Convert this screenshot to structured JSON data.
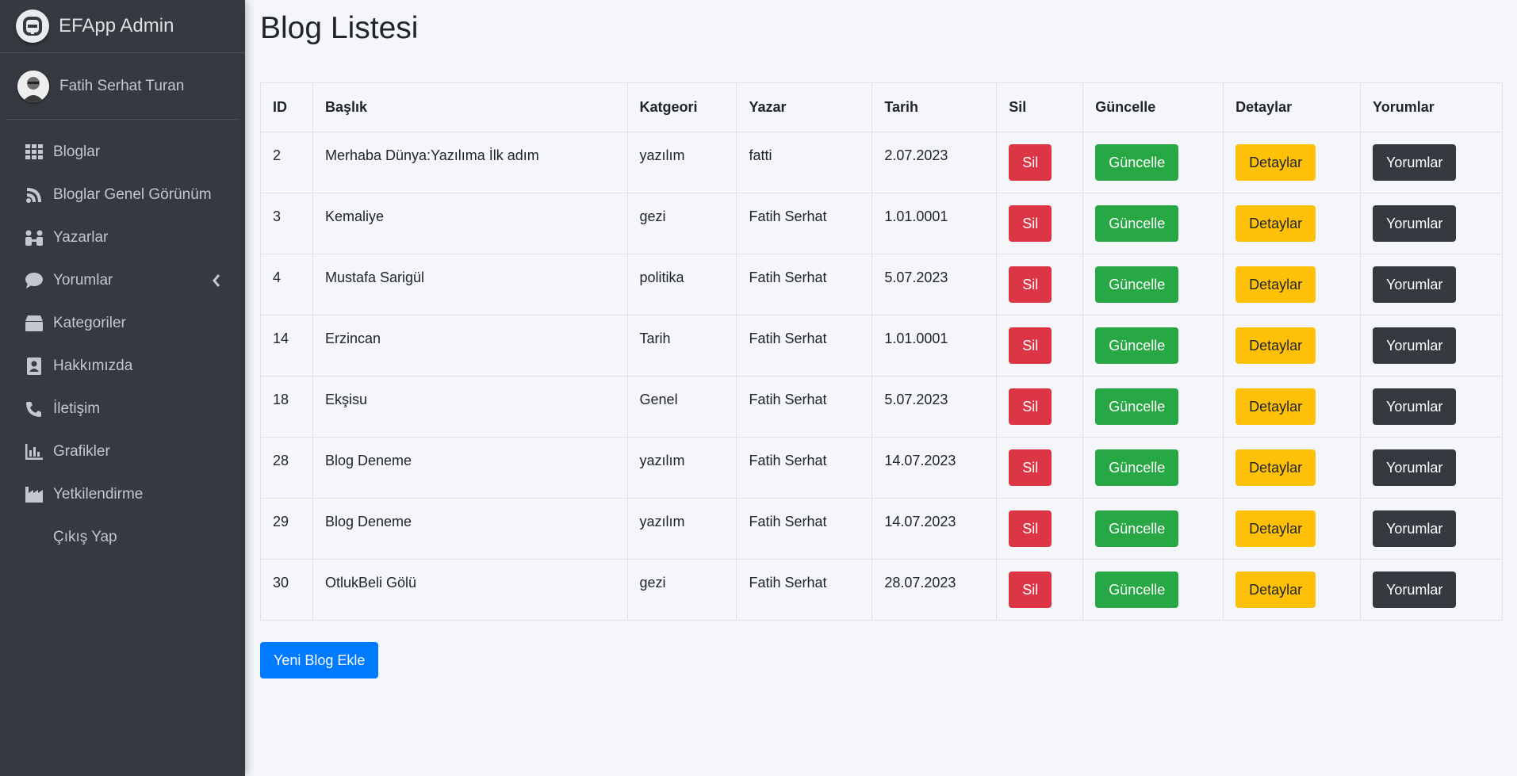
{
  "brand": {
    "title": "EFApp Admin"
  },
  "user": {
    "name": "Fatih Serhat Turan"
  },
  "sidebar": {
    "items": [
      {
        "label": "Bloglar",
        "icon": "grid-icon"
      },
      {
        "label": "Bloglar Genel Görünüm",
        "icon": "blog-icon"
      },
      {
        "label": "Yazarlar",
        "icon": "people-icon"
      },
      {
        "label": "Yorumlar",
        "icon": "comment-icon"
      },
      {
        "label": "Kategoriler",
        "icon": "box-icon"
      },
      {
        "label": "Hakkımızda",
        "icon": "contact-card-icon"
      },
      {
        "label": "İletişim",
        "icon": "phone-icon"
      },
      {
        "label": "Grafikler",
        "icon": "bar-chart-icon"
      },
      {
        "label": "Yetkilendirme",
        "icon": "industry-icon"
      },
      {
        "label": "Çıkış Yap",
        "icon": ""
      }
    ]
  },
  "page": {
    "title": "Blog Listesi"
  },
  "table": {
    "headers": [
      "ID",
      "Başlık",
      "Katgeori",
      "Yazar",
      "Tarih",
      "Sil",
      "Güncelle",
      "Detaylar",
      "Yorumlar"
    ],
    "rows": [
      {
        "id": "2",
        "title": "Merhaba Dünya:Yazılıma İlk adım",
        "category": "yazılım",
        "author": "fatti",
        "date": "2.07.2023"
      },
      {
        "id": "3",
        "title": "Kemaliye",
        "category": "gezi",
        "author": "Fatih Serhat",
        "date": "1.01.0001"
      },
      {
        "id": "4",
        "title": "Mustafa Sarigül",
        "category": "politika",
        "author": "Fatih Serhat",
        "date": "5.07.2023"
      },
      {
        "id": "14",
        "title": "Erzincan",
        "category": "Tarih",
        "author": "Fatih Serhat",
        "date": "1.01.0001"
      },
      {
        "id": "18",
        "title": "Ekşisu",
        "category": "Genel",
        "author": "Fatih Serhat",
        "date": "5.07.2023"
      },
      {
        "id": "28",
        "title": "Blog Deneme",
        "category": "yazılım",
        "author": "Fatih Serhat",
        "date": "14.07.2023"
      },
      {
        "id": "29",
        "title": "Blog Deneme",
        "category": "yazılım",
        "author": "Fatih Serhat",
        "date": "14.07.2023"
      },
      {
        "id": "30",
        "title": "OtlukBeli Gölü",
        "category": "gezi",
        "author": "Fatih Serhat",
        "date": "28.07.2023"
      }
    ],
    "buttons": {
      "delete": "Sil",
      "update": "Güncelle",
      "details": "Detaylar",
      "comments": "Yorumlar"
    }
  },
  "actions": {
    "add_blog": "Yeni Blog Ekle"
  },
  "colors": {
    "sidebar_bg": "#343a40",
    "danger": "#dc3545",
    "success": "#28a745",
    "warning": "#ffc107",
    "dark": "#343a40",
    "primary": "#007bff"
  }
}
